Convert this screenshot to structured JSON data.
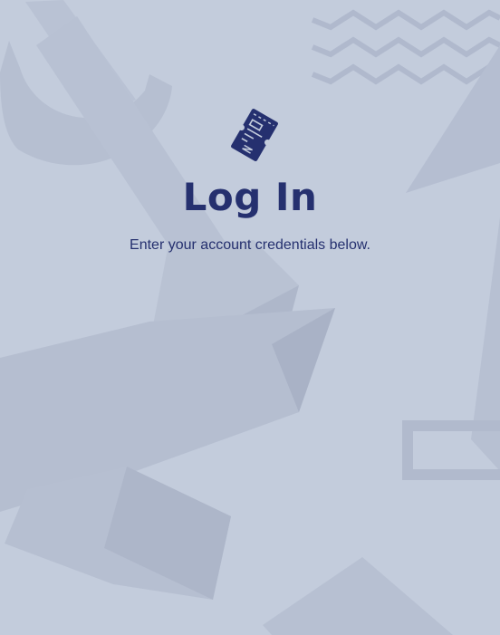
{
  "page": {
    "title": "Log In",
    "subtitle": "Enter your account credentials below."
  },
  "brand": {
    "logo_icon": "ticket-icon",
    "logo_color": "#25306f"
  },
  "colors": {
    "background": "#c3ccdc",
    "text": "#25306f"
  }
}
